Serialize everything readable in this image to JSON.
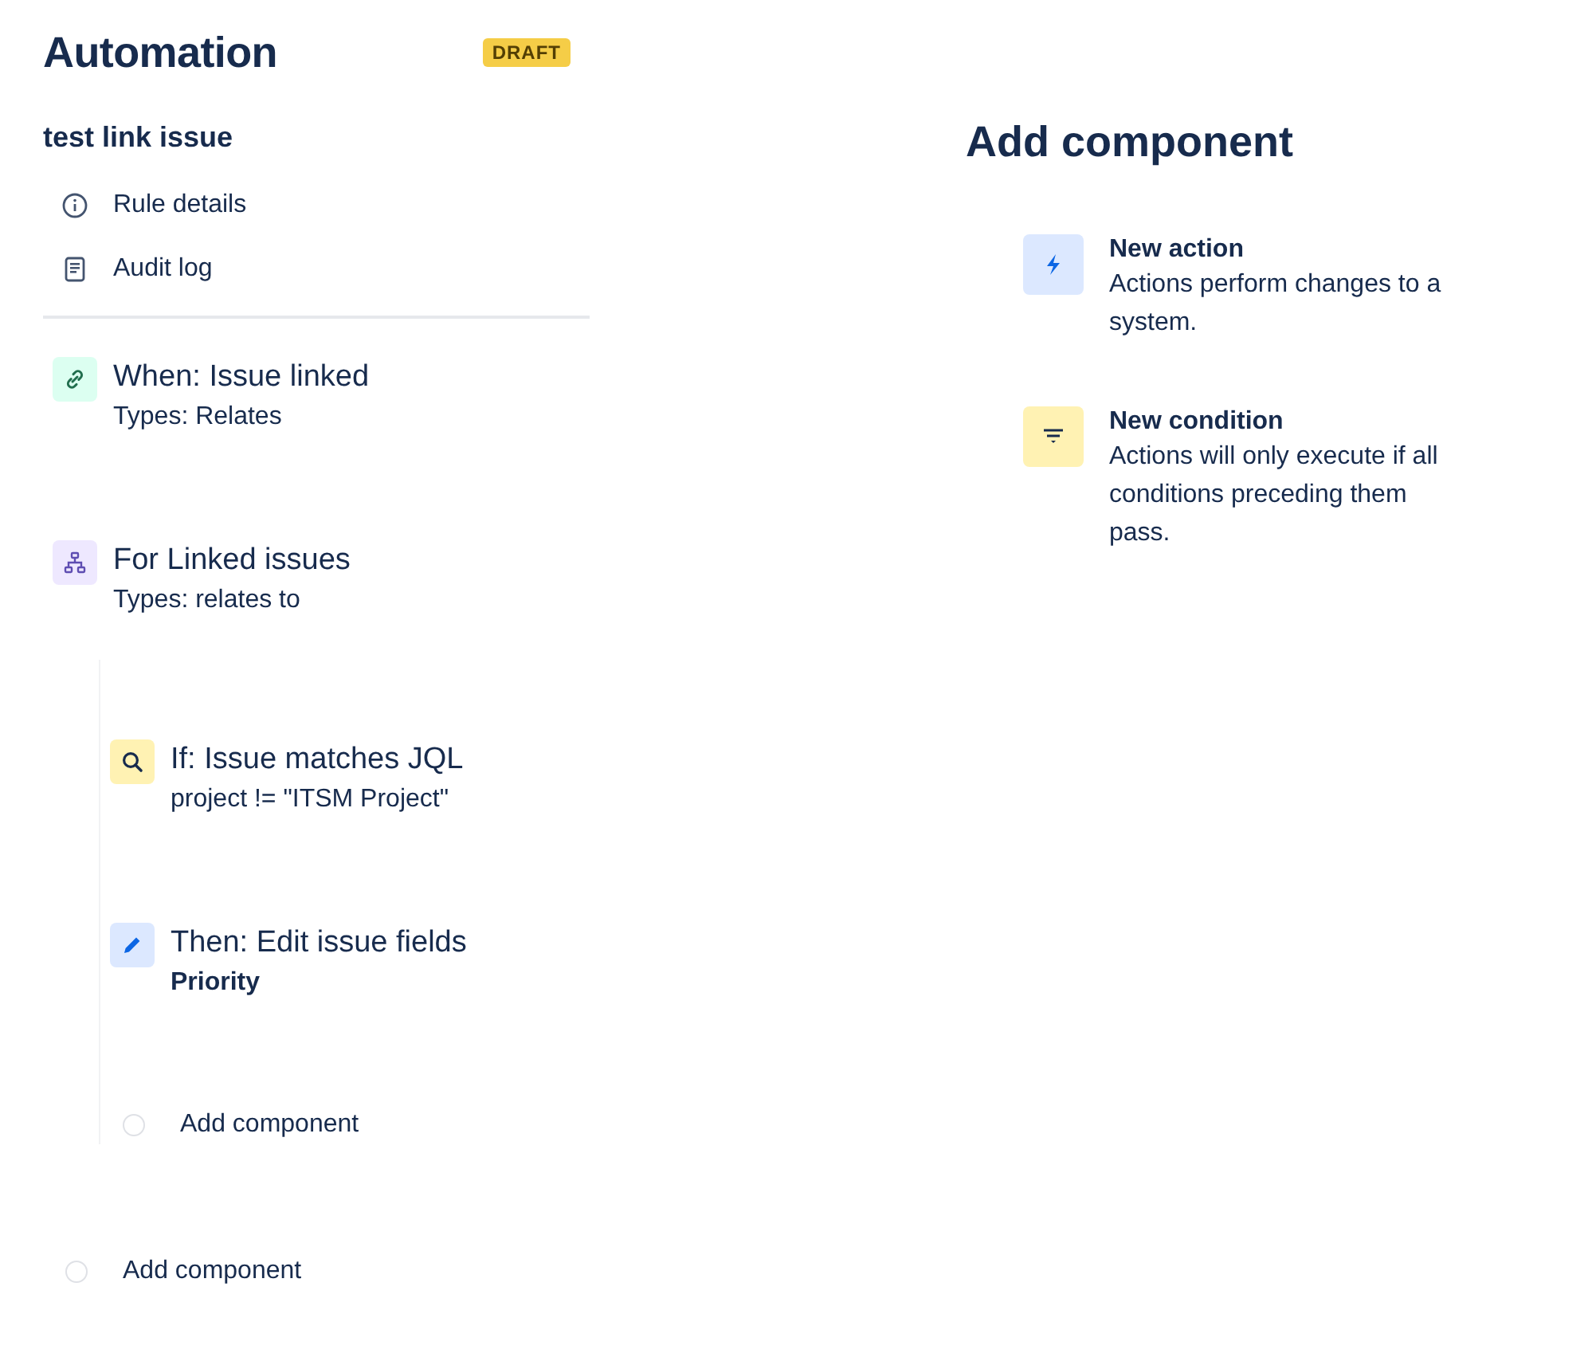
{
  "header": {
    "title": "Automation",
    "status_badge": "DRAFT"
  },
  "rule": {
    "name": "test link issue",
    "links": [
      {
        "kind": "info",
        "label": "Rule details"
      },
      {
        "kind": "log",
        "label": "Audit log"
      }
    ]
  },
  "steps": [
    {
      "kind": "trigger",
      "title": "When: Issue linked",
      "detail": "Types: Relates"
    },
    {
      "kind": "branch",
      "title": "For Linked issues",
      "detail": "Types: relates to",
      "children": [
        {
          "kind": "condition",
          "title": "If: Issue matches JQL",
          "detail": "project != \"ITSM Project\""
        },
        {
          "kind": "action",
          "title": "Then: Edit issue fields",
          "detail": "Priority",
          "detail_bold": true
        },
        {
          "kind": "add",
          "title": "Add component"
        }
      ]
    },
    {
      "kind": "add",
      "title": "Add component"
    }
  ],
  "panel": {
    "title": "Add component",
    "options": [
      {
        "kind": "action",
        "title": "New action",
        "description": "Actions perform changes to a system."
      },
      {
        "kind": "condition",
        "title": "New condition",
        "description": "Actions will only execute if all conditions preceding them pass."
      }
    ]
  }
}
